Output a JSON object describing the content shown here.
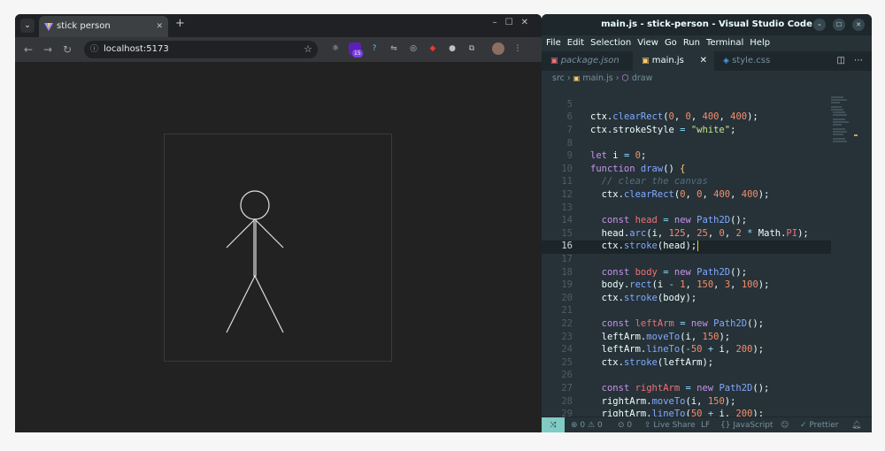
{
  "browser": {
    "tab_title": "stick person",
    "url": "localhost:5173",
    "extension_badge": "15"
  },
  "vscode": {
    "window_title": "main.js - stick-person - Visual Studio Code",
    "menu": [
      "File",
      "Edit",
      "Selection",
      "View",
      "Go",
      "Run",
      "Terminal",
      "Help"
    ],
    "tabs": [
      {
        "label": "package.json",
        "icon": "json-icon"
      },
      {
        "label": "main.js",
        "icon": "js-icon",
        "active": true
      },
      {
        "label": "style.css",
        "icon": "css-icon"
      }
    ],
    "breadcrumb": {
      "folder": "src",
      "file": "main.js",
      "symbol": "draw"
    },
    "current_line": 16,
    "status": {
      "errors": "0",
      "warnings": "0",
      "ports": "0",
      "live_share": "Live Share",
      "eol": "LF",
      "language": "JavaScript",
      "prettier": "Prettier"
    }
  },
  "accent_color": "#80cbc4"
}
